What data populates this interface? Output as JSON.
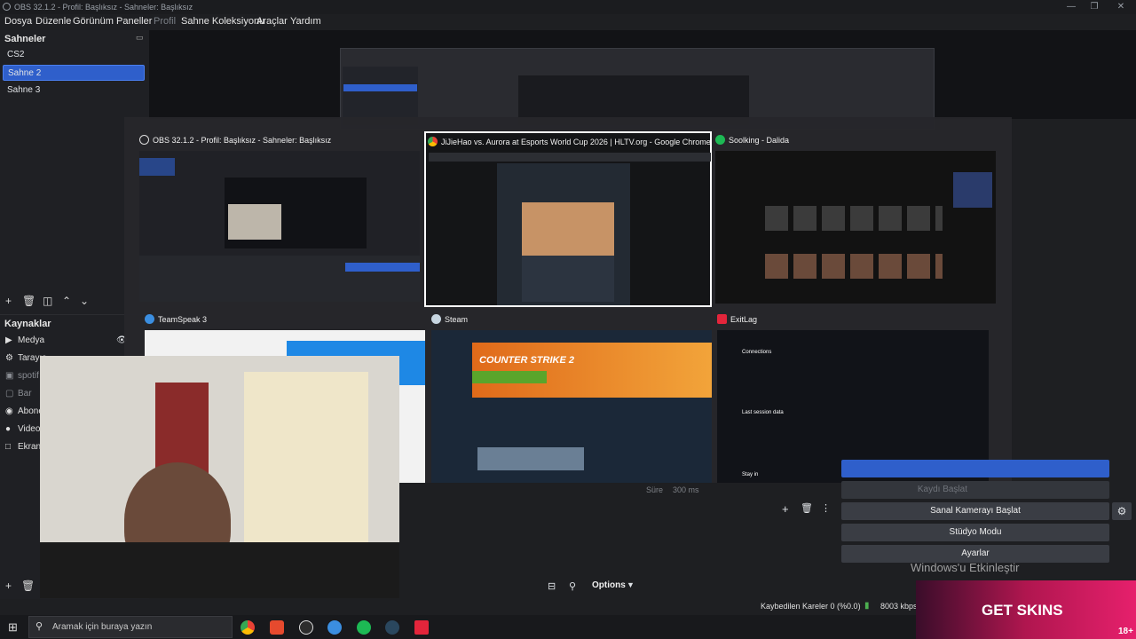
{
  "window": {
    "title": "OBS 32.1.2 - Profil: Başlıksız - Sahneler: Başlıksız"
  },
  "menu": [
    "Dosya",
    "Düzenle",
    "Görünüm",
    "Paneller",
    "Profil",
    "Sahne Koleksiyonu",
    "Araçlar",
    "Yardım"
  ],
  "scenes": {
    "title": "Sahneler",
    "items": [
      "CS2",
      "Sahne 2",
      "Sahne 3"
    ],
    "selected": "Sahne 2"
  },
  "sources": {
    "title": "Kaynaklar",
    "items": [
      {
        "label": "Medya",
        "icon": "play-icon"
      },
      {
        "label": "Tarayıc",
        "icon": "globe-icon"
      },
      {
        "label": "spotif",
        "icon": "window-icon"
      },
      {
        "label": "Bar",
        "icon": "image-icon"
      },
      {
        "label": "Abone",
        "icon": "globe-icon"
      },
      {
        "label": "Video",
        "icon": "camera-icon"
      },
      {
        "label": "Ekran",
        "icon": "monitor-icon"
      }
    ]
  },
  "switcher": {
    "windows": [
      {
        "title": "OBS 32.1.2 - Profil: Başlıksız - Sahneler: Başlıksız",
        "icon": "obs-icon",
        "color": "#dddddd",
        "active": false
      },
      {
        "title": "JiJieHao vs. Aurora at Esports World Cup 2026 | HLTV.org - Google Chrome",
        "icon": "chrome-icon",
        "color": "#e8b43b",
        "active": true
      },
      {
        "title": "Soolking - Dalida",
        "icon": "spotify-icon",
        "color": "#1db954",
        "active": false
      },
      {
        "title": "TeamSpeak 3",
        "icon": "teamspeak-icon",
        "color": "#3b8ee0",
        "active": false
      },
      {
        "title": "Steam",
        "icon": "steam-icon",
        "color": "#c7d5e0",
        "active": false
      },
      {
        "title": "ExitLag",
        "icon": "exitlag-icon",
        "color": "#e3253b",
        "active": false
      }
    ],
    "exitlag": {
      "connections": "Connections",
      "last_session": "Last session data",
      "stay_in": "Stay in"
    },
    "steam_logo": "COUNTER STRIKE 2"
  },
  "controls": {
    "virtual_cam": "Sanal Kamerayı Başlat",
    "studio_mode": "Stüdyo Modu",
    "settings": "Ayarlar",
    "record": "Kaydı Başlat",
    "options": "Options",
    "duration_label": "Süre",
    "duration_value": "300 ms"
  },
  "status": {
    "dropped": "Kaybedilen Kareler 0 (%0.0)",
    "bitrate": "8003 kbps"
  },
  "taskbar": {
    "search_placeholder": "Aramak için buraya yazın"
  },
  "overlay": {
    "watermark": "Windows'u Etkinleştir",
    "ad": "GET SKINS",
    "rating": "18+"
  },
  "colors": {
    "accent": "#2f5fcb",
    "chrome_yellow": "#e8b43b",
    "spotify": "#1db954",
    "exitlag": "#e3253b"
  }
}
